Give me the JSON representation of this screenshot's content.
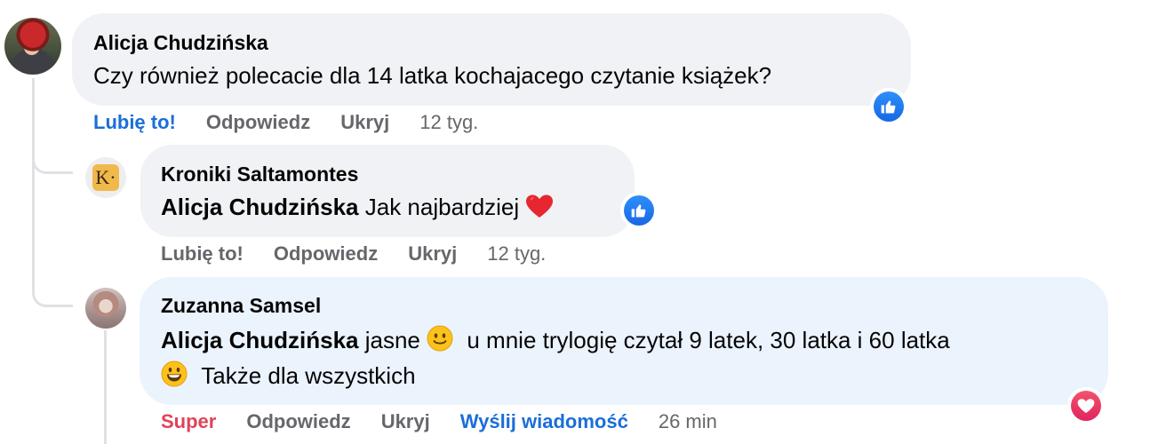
{
  "comments": [
    {
      "author": "Alicja Chudzińska",
      "text": "Czy również polecacie dla 14 latka kochajacego czytanie książek?",
      "reaction": "like-icon",
      "actions": {
        "like": "Lubię to!",
        "reply": "Odpowiedz",
        "hide": "Ukryj",
        "time": "12 tyg."
      }
    },
    {
      "author": "Kroniki Saltamontes",
      "avatar_letter": "K·",
      "mention": "Alicja Chudzińska",
      "text": "Jak najbardziej",
      "emoji": "red-heart-emoji",
      "reaction": "like-icon",
      "actions": {
        "like": "Lubię to!",
        "reply": "Odpowiedz",
        "hide": "Ukryj",
        "time": "12 tyg."
      }
    },
    {
      "author": "Zuzanna Samsel",
      "mention": "Alicja Chudzińska",
      "text_a": "jasne",
      "text_b": "u mnie trylogię czytał 9 latek, 30 latka i 60 latka",
      "text_c": "Także dla wszystkich",
      "reaction": "love-icon",
      "actions": {
        "like": "Super",
        "reply": "Odpowiedz",
        "hide": "Ukryj",
        "message": "Wyślij wiadomość",
        "time": "26 min"
      }
    }
  ],
  "colors": {
    "bubble": "#f0f2f5",
    "bubble_highlight": "#ebf3fd",
    "like_blue": "#1a6ed8",
    "super_red": "#e0435a",
    "muted": "#65676b"
  }
}
